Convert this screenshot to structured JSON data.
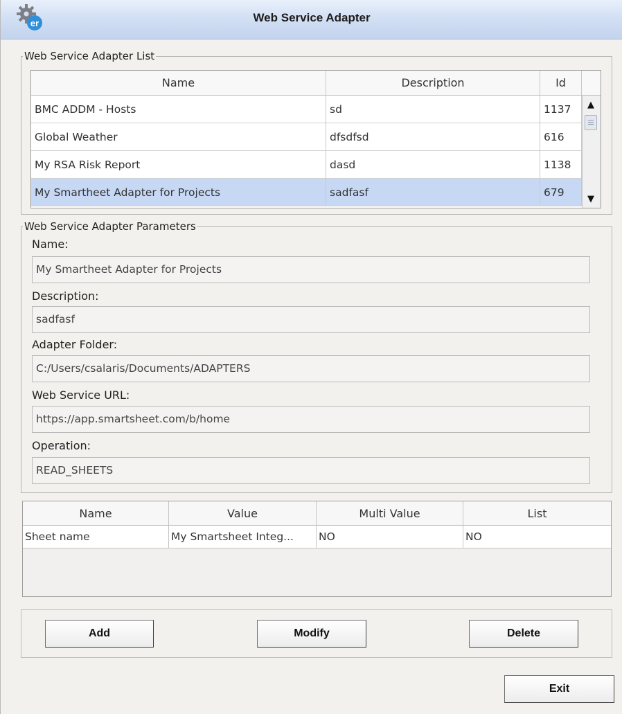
{
  "window": {
    "title": "Web Service Adapter"
  },
  "adapter_list": {
    "legend": "Web Service Adapter List",
    "columns": [
      "Name",
      "Description",
      "Id"
    ],
    "rows": [
      {
        "name": "BMC ADDM - Hosts",
        "description": "sd",
        "id": "1137"
      },
      {
        "name": "Global Weather",
        "description": "dfsdfsd",
        "id": "616"
      },
      {
        "name": "My RSA Risk Report",
        "description": "dasd",
        "id": "1138"
      },
      {
        "name": "My Smartheet Adapter for Projects",
        "description": "sadfasf",
        "id": "679"
      }
    ],
    "selected_row_index": 3
  },
  "parameters": {
    "legend": "Web Service Adapter Parameters",
    "name_label": "Name:",
    "name_value": "My Smartheet Adapter for Projects",
    "description_label": "Description:",
    "description_value": "sadfasf",
    "folder_label": "Adapter Folder:",
    "folder_value": "C:/Users/csalaris/Documents/ADAPTERS",
    "url_label": "Web Service URL:",
    "url_value": "https://app.smartsheet.com/b/home",
    "operation_label": "Operation:",
    "operation_value": "READ_SHEETS"
  },
  "param_table": {
    "columns": [
      "Name",
      "Value",
      "Multi Value",
      "List"
    ],
    "rows": [
      {
        "name": "Sheet name",
        "value": "My Smartsheet Integ...",
        "multi_value": "NO",
        "list": "NO"
      }
    ]
  },
  "buttons": {
    "add": "Add",
    "modify": "Modify",
    "delete": "Delete",
    "exit": "Exit"
  },
  "colors": {
    "selection": "#c7d8f4",
    "titlebar": "#d3e0f4"
  },
  "icons": {
    "app": "er-gear-icon"
  }
}
